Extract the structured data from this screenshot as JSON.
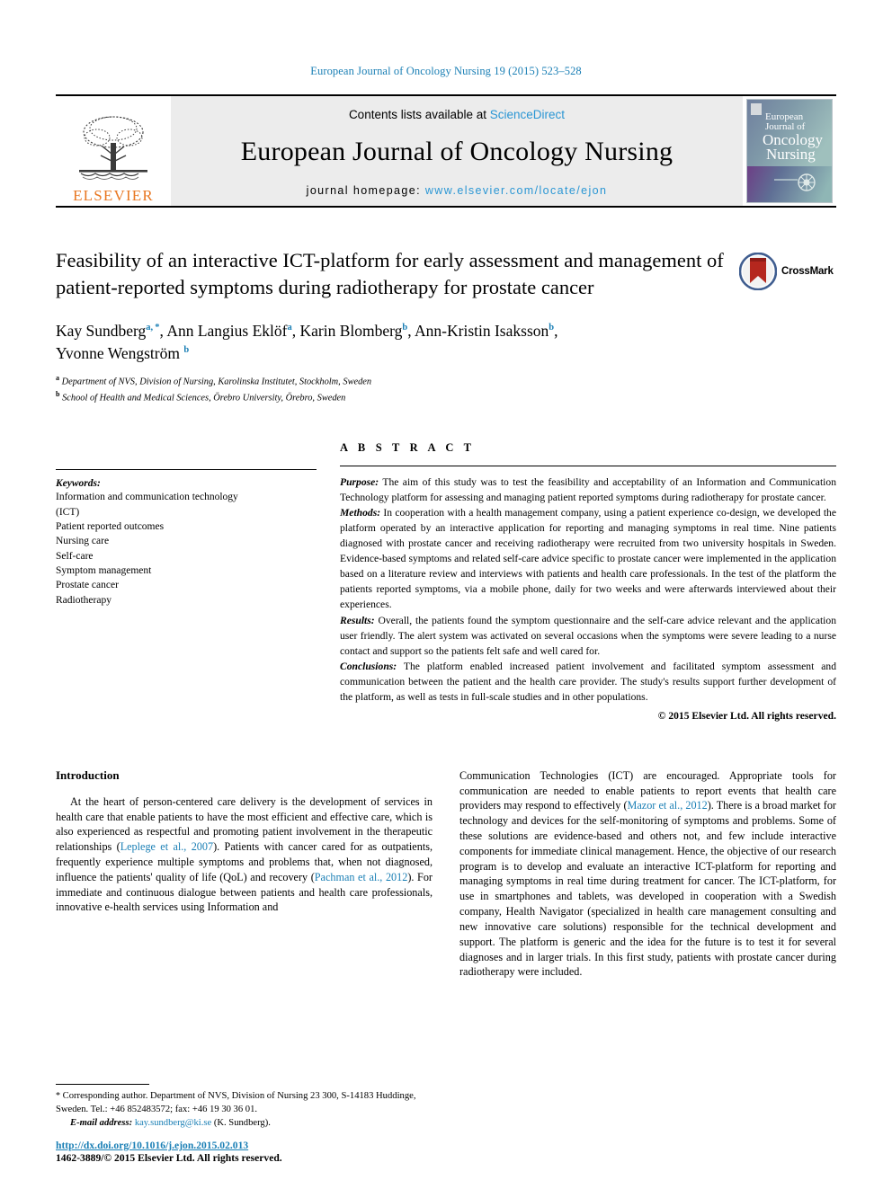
{
  "running_head": "European Journal of Oncology Nursing 19 (2015) 523–528",
  "masthead": {
    "publisher_name": "ELSEVIER",
    "contents_prefix": "Contents lists available at ",
    "contents_link": "ScienceDirect",
    "journal_name": "European Journal of Oncology Nursing",
    "homepage_label": "journal homepage: ",
    "homepage_url": "www.elsevier.com/locate/ejon",
    "cover_lines": [
      "European",
      "Journal of",
      "Oncology",
      "Nursing"
    ]
  },
  "article": {
    "title": "Feasibility of an interactive ICT-platform for early assessment and management of patient-reported symptoms during radiotherapy for prostate cancer",
    "crossmark_label": "CrossMark",
    "authors_line_1_parts": [
      {
        "text": "Kay Sundberg ",
        "sup": "a, *"
      },
      {
        "text": ", Ann Langius Eklöf ",
        "sup": "a"
      },
      {
        "text": ", Karin Blomberg ",
        "sup": "b"
      },
      {
        "text": ", Ann-Kristin Isaksson ",
        "sup": "b"
      }
    ],
    "authors_plain": "Kay Sundberg a, *, Ann Langius Eklöf a, Karin Blomberg b, Ann-Kristin Isaksson b, Yvonne Wengström b",
    "author_last": "Yvonne Wengström ",
    "author_last_sup": "b",
    "affiliation_a_sup": "a",
    "affiliation_a": "Department of NVS, Division of Nursing, Karolinska Institutet, Stockholm, Sweden",
    "affiliation_b_sup": "b",
    "affiliation_b": "School of Health and Medical Sciences, Örebro University, Örebro, Sweden"
  },
  "keywords": {
    "heading": "Keywords:",
    "items": [
      "Information and communication technology",
      "(ICT)",
      "Patient reported outcomes",
      "Nursing care",
      "Self-care",
      "Symptom management",
      "Prostate cancer",
      "Radiotherapy"
    ]
  },
  "abstract": {
    "heading": "A B S T R A C T",
    "purpose_label": "Purpose:",
    "purpose_text": " The aim of this study was to test the feasibility and acceptability of an Information and Communication Technology platform for assessing and managing patient reported symptoms during radiotherapy for prostate cancer.",
    "methods_label": "Methods:",
    "methods_text": " In cooperation with a health management company, using a patient experience co-design, we developed the platform operated by an interactive application for reporting and managing symptoms in real time. Nine patients diagnosed with prostate cancer and receiving radiotherapy were recruited from two university hospitals in Sweden. Evidence-based symptoms and related self-care advice specific to prostate cancer were implemented in the application based on a literature review and interviews with patients and health care professionals. In the test of the platform the patients reported symptoms, via a mobile phone, daily for two weeks and were afterwards interviewed about their experiences.",
    "results_label": "Results:",
    "results_text": " Overall, the patients found the symptom questionnaire and the self-care advice relevant and the application user friendly. The alert system was activated on several occasions when the symptoms were severe leading to a nurse contact and support so the patients felt safe and well cared for.",
    "conclusions_label": "Conclusions:",
    "conclusions_text": " The platform enabled increased patient involvement and facilitated symptom assessment and communication between the patient and the health care provider. The study's results support further development of the platform, as well as tests in full-scale studies and in other populations.",
    "copyright": "© 2015 Elsevier Ltd. All rights reserved."
  },
  "introduction": {
    "heading": "Introduction",
    "left_paragraph_1": "At the heart of person-centered care delivery is the development of services in health care that enable patients to have the most efficient and effective care, which is also experienced as respectful and promoting patient involvement in the therapeutic relationships (",
    "left_ref_1": "Leplege et al., 2007",
    "left_paragraph_2": "). Patients with cancer cared for as outpatients, frequently experience multiple symptoms and problems that, when not diagnosed, influence the patients' quality of life (QoL) and recovery (",
    "left_ref_2": "Pachman et al., 2012",
    "left_paragraph_3": "). For immediate and continuous dialogue between patients and health care professionals, innovative e-health services using Information and",
    "right_paragraph_1": "Communication Technologies (ICT) are encouraged. Appropriate tools for communication are needed to enable patients to report events that health care providers may respond to effectively (",
    "right_ref_1": "Mazor et al., 2012",
    "right_paragraph_2": "). There is a broad market for technology and devices for the self-monitoring of symptoms and problems. Some of these solutions are evidence-based and others not, and few include interactive components for immediate clinical management. Hence, the objective of our research program is to develop and evaluate an interactive ICT-platform for reporting and managing symptoms in real time during treatment for cancer. The ICT-platform, for use in smartphones and tablets, was developed in cooperation with a Swedish company, Health Navigator (specialized in health care management consulting and new innovative care solutions) responsible for the technical development and support. The platform is generic and the idea for the future is to test it for several diagnoses and in larger trials. In this first study, patients with prostate cancer during radiotherapy were included."
  },
  "footnotes": {
    "corresponding_marker": "*",
    "corresponding_text": " Corresponding author. Department of NVS, Division of Nursing 23 300, S-14183 Huddinge, Sweden. Tel.: +46 852483572; fax: +46 19 30 36 01.",
    "email_label": "E-mail address:",
    "email_value": "kay.sundberg@ki.se",
    "email_suffix": " (K. Sundberg).",
    "doi": "http://dx.doi.org/10.1016/j.ejon.2015.02.013",
    "issn_line": "1462-3889/© 2015 Elsevier Ltd. All rights reserved."
  },
  "colors": {
    "link_blue": "#1a7fb5",
    "sciencedirect_blue": "#2a96d4",
    "elsevier_orange": "#E87722",
    "masthead_gray": "#ececec"
  }
}
